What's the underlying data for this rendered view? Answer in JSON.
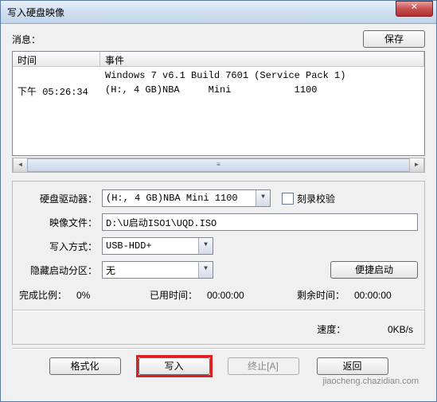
{
  "window": {
    "title": "写入硬盘映像",
    "close_symbol": "✕"
  },
  "header": {
    "msg_label": "消息：",
    "save_btn": "保存"
  },
  "log": {
    "col_time": "时间",
    "col_event": "事件",
    "rows": [
      {
        "time": "",
        "event": "Windows 7 v6.1 Build 7601 (Service Pack 1)"
      },
      {
        "time": "下午 05:26:34",
        "event": "(H:, 4 GB)NBA     Mini           1100"
      }
    ]
  },
  "form": {
    "drive_label": "硬盘驱动器：",
    "drive_value": "(H:, 4 GB)NBA     Mini           1100",
    "verify_label": "刻录校验",
    "image_label": "映像文件：",
    "image_value": "D:\\U启动ISO1\\UQD.ISO",
    "write_mode_label": "写入方式：",
    "write_mode_value": "USB-HDD+",
    "hide_boot_label": "隐藏启动分区：",
    "hide_boot_value": "无",
    "convenient_boot_btn": "便捷启动"
  },
  "stats": {
    "complete_label": "完成比例：",
    "complete_value": "0%",
    "elapsed_label": "已用时间：",
    "elapsed_value": "00:00:00",
    "remain_label": "剩余时间：",
    "remain_value": "00:00:00",
    "speed_label": "速度：",
    "speed_value": "0KB/s"
  },
  "actions": {
    "format": "格式化",
    "write": "写入",
    "abort": "终止[A]",
    "return": "返回"
  },
  "watermark": "jiaocheng.chazidian.com"
}
